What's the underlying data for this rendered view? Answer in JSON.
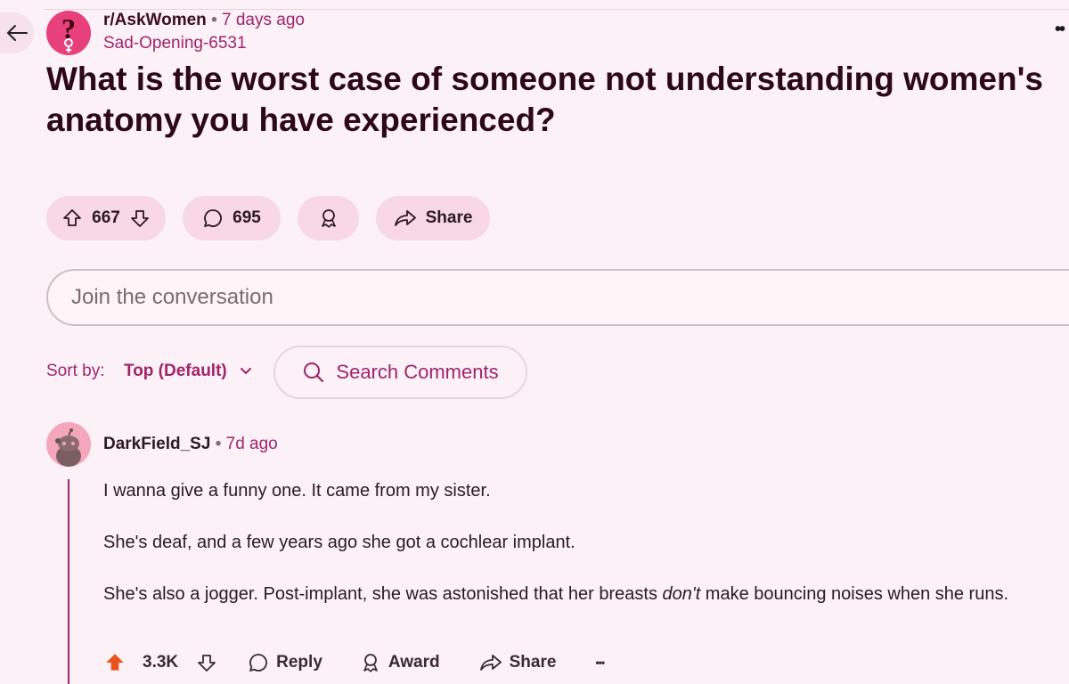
{
  "post": {
    "subreddit": "r/AskWomen",
    "separator": "•",
    "posted_time": "7 days ago",
    "author": "Sad-Opening-6531",
    "title": "What is the worst case of someone not understanding women's anatomy you have experienced?",
    "votes": "667",
    "comments_count": "695",
    "share_label": "Share"
  },
  "composer": {
    "placeholder": "Join the conversation"
  },
  "sort": {
    "label": "Sort by:",
    "value": "Top (Default)",
    "search_label": "Search Comments"
  },
  "comment": {
    "author": "DarkField_SJ",
    "separator": "•",
    "time": "7d ago",
    "paragraphs": [
      "I wanna give a funny one. It came from my sister.",
      "She's deaf, and a few years ago she got a cochlear implant.",
      "She's also a jogger. Post-implant, she was astonished that her breasts don't make bouncing noises when she runs."
    ],
    "emphasis_word": "don't",
    "score": "3.3K",
    "reply_label": "Reply",
    "award_label": "Award",
    "share_label": "Share"
  },
  "colors": {
    "background": "#fcf1f6",
    "accent": "#a0246a",
    "pill": "#f9d8e6",
    "upvote": "#e8541a",
    "subreddit_icon": "#e8407a"
  },
  "icons": [
    "back-arrow-icon",
    "more-icon",
    "subreddit-icon",
    "upvote-icon",
    "downvote-icon",
    "comment-icon",
    "award-icon",
    "share-icon",
    "chevron-down-icon",
    "search-icon",
    "snoo-avatar-icon"
  ]
}
